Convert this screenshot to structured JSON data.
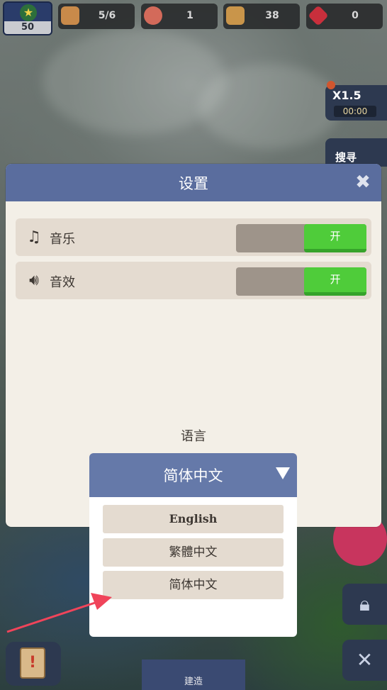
{
  "hud": {
    "level": "50",
    "population": "5/6",
    "food": "1",
    "wood": "38",
    "gems": "0",
    "speed_label": "X1.5",
    "speed_timer": "00:00",
    "search_label": "搜寻",
    "build_label": "建造"
  },
  "settings": {
    "title": "设置",
    "music_label": "音乐",
    "music_toggle": "开",
    "sfx_label": "音效",
    "sfx_toggle": "开",
    "language_label": "语言"
  },
  "language_dropdown": {
    "selected": "简体中文",
    "options": [
      "English",
      "繁體中文",
      "简体中文"
    ]
  },
  "colors": {
    "accent_blue": "#5a6d9e",
    "toggle_on": "#4fcc3a",
    "panel": "#f3efe7",
    "row": "#e4dbd0",
    "pointer_arrow": "#f0445a"
  },
  "icons": [
    "level-star-icon",
    "villager-icon",
    "food-icon",
    "wood-icon",
    "gem-icon",
    "music-note-icon",
    "speaker-icon",
    "close-icon",
    "dropdown-arrow-icon",
    "clipboard-icon",
    "lock-icon"
  ]
}
